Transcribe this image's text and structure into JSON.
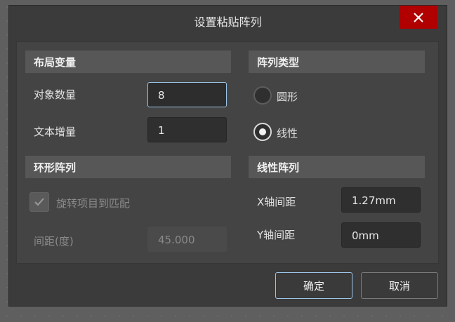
{
  "dialog": {
    "title": "设置粘贴阵列",
    "close_icon": "close-icon"
  },
  "layout_vars": {
    "header": "布局变量",
    "object_count_label": "对象数量",
    "object_count_value": "8",
    "text_increment_label": "文本增量",
    "text_increment_value": "1"
  },
  "array_type": {
    "header": "阵列类型",
    "option_circular": "圆形",
    "option_linear": "线性",
    "selected": "线性"
  },
  "circular_array": {
    "header": "环形阵列",
    "rotate_label": "旋转项目到匹配",
    "rotate_checked": true,
    "spacing_label": "间距(度)",
    "spacing_value": "45.000"
  },
  "linear_array": {
    "header": "线性阵列",
    "x_spacing_label": "X轴间距",
    "x_spacing_value": "1.27mm",
    "y_spacing_label": "Y轴间距",
    "y_spacing_value": "0mm"
  },
  "buttons": {
    "ok": "确定",
    "cancel": "取消"
  },
  "colors": {
    "close_button": "#b00000",
    "focus_border": "#9cc5e8"
  }
}
